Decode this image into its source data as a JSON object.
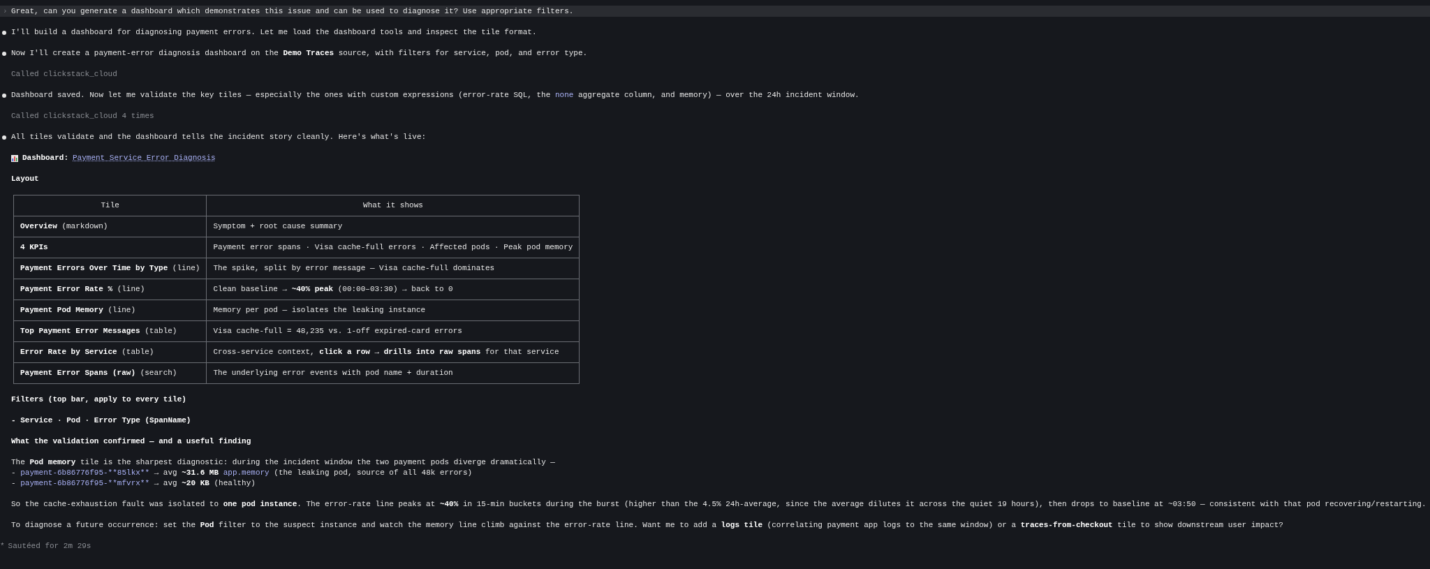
{
  "prompt": {
    "marker": "›",
    "text": "Great, can you generate a dashboard which demonstrates this issue and can be used to diagnose it? Use appropriate filters."
  },
  "transcript": [
    {
      "kind": "bullet",
      "segments": [
        {
          "kind": "text",
          "text": "I'll build a dashboard for diagnosing payment errors. Let me load the dashboard tools and inspect the tile format."
        }
      ]
    },
    {
      "kind": "bullet",
      "segments": [
        {
          "kind": "text",
          "text": "Now I'll create a payment-error diagnosis dashboard on the **Demo Traces** source, with filters for service, pod, and error type."
        }
      ]
    },
    {
      "kind": "tool",
      "text": "Called clickstack_cloud"
    },
    {
      "kind": "bullet",
      "segments": [
        {
          "kind": "text",
          "text": "Dashboard saved. Now let me validate the key tiles — especially the ones with custom expressions (error-rate SQL, the "
        },
        {
          "kind": "code",
          "text": "none"
        },
        {
          "kind": "text",
          "text": " aggregate column, and memory) — over the 24h incident window."
        }
      ]
    },
    {
      "kind": "tool",
      "text": "Called clickstack_cloud 4 times"
    },
    {
      "kind": "bullet",
      "segments": [
        {
          "kind": "text",
          "text": "All tiles validate and the dashboard tells the incident story cleanly. Here's what's live:"
        }
      ]
    },
    {
      "kind": "dashboard_link",
      "label": "Dashboard:",
      "link": "Payment Service Error Diagnosis"
    },
    {
      "kind": "heading",
      "text": "Layout"
    },
    {
      "kind": "table",
      "columns": [
        "Tile",
        "What it shows"
      ],
      "rows": [
        {
          "tile": "**Overview** (markdown)",
          "shows": "Symptom + root cause summary"
        },
        {
          "tile": "**4 KPIs**",
          "shows": "Payment error spans · Visa cache-full errors · Affected pods · Peak pod memory"
        },
        {
          "tile": "**Payment Errors Over Time by Type** (line)",
          "shows": "The spike, split by error message — Visa cache-full dominates"
        },
        {
          "tile": "**Payment Error Rate %** (line)",
          "shows": "Clean baseline → **~40% peak** (00:00–03:30) → back to 0"
        },
        {
          "tile": "**Payment Pod Memory** (line)",
          "shows": "Memory per pod — isolates the leaking instance"
        },
        {
          "tile": "**Top Payment Error Messages** (table)",
          "shows": "Visa cache-full = 48,235 vs. 1-off expired-card errors"
        },
        {
          "tile": "**Error Rate by Service** (table)",
          "shows": "Cross-service context, **click a row → drills into raw spans** for that service"
        },
        {
          "tile": "**Payment Error Spans (raw)** (search)",
          "shows": "The underlying error events with pod name + duration"
        }
      ]
    },
    {
      "kind": "heading",
      "text": "Filters (top bar, apply to every tile)"
    },
    {
      "kind": "heading",
      "text": "- Service · Pod · Error Type (SpanName)"
    },
    {
      "kind": "heading",
      "text": "What the validation confirmed — and a useful finding"
    },
    {
      "kind": "paragraph",
      "lines": [
        [
          {
            "kind": "text",
            "text": "The **Pod memory** tile is the sharpest diagnostic: during the incident window the two payment pods diverge dramatically —"
          }
        ],
        [
          {
            "kind": "text",
            "text": "- "
          },
          {
            "kind": "code",
            "text": "payment-6b86776f95-**85lkx**"
          },
          {
            "kind": "text",
            "text": " → avg **~31.6 MB** "
          },
          {
            "kind": "code",
            "text": "app.memory"
          },
          {
            "kind": "text",
            "text": " (the leaking pod, source of all 48k errors)"
          }
        ],
        [
          {
            "kind": "text",
            "text": "- "
          },
          {
            "kind": "code",
            "text": "payment-6b86776f95-**mfvrx**"
          },
          {
            "kind": "text",
            "text": " → avg **~20 KB** (healthy)"
          }
        ]
      ]
    },
    {
      "kind": "paragraph",
      "lines": [
        [
          {
            "kind": "text",
            "text": "So the cache-exhaustion fault was isolated to **one pod instance**. The error-rate line peaks at **~40%** in 15-min buckets during the burst (higher than the 4.5% 24h-average, since the average dilutes it across the quiet 19 hours), then drops to baseline at ~03:50 — consistent with that pod recovering/restarting."
          }
        ]
      ]
    },
    {
      "kind": "paragraph",
      "lines": [
        [
          {
            "kind": "text",
            "text": "To diagnose a future occurrence: set the **Pod** filter to the suspect instance and watch the memory line climb against the error-rate line. Want me to add a **logs tile** (correlating payment app logs to the same window) or a **traces-from-checkout** tile to show downstream user impact?"
          }
        ]
      ]
    }
  ],
  "status": {
    "marker": "*",
    "text": "Sautéed for 2m 29s"
  }
}
